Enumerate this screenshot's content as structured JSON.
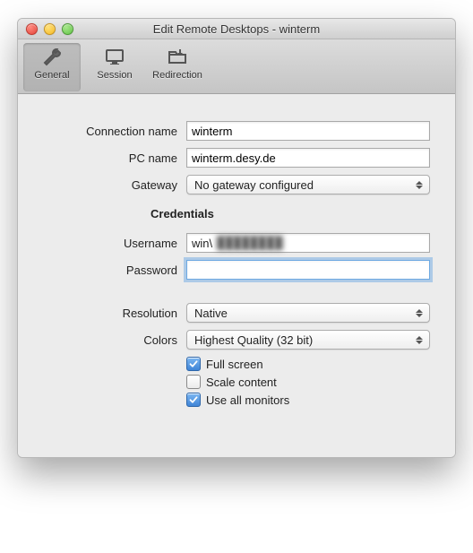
{
  "window": {
    "title": "Edit Remote Desktops - winterm"
  },
  "toolbar": {
    "general": "General",
    "session": "Session",
    "redirection": "Redirection"
  },
  "labels": {
    "connection_name": "Connection name",
    "pc_name": "PC name",
    "gateway": "Gateway",
    "credentials": "Credentials",
    "username": "Username",
    "password": "Password",
    "resolution": "Resolution",
    "colors": "Colors",
    "full_screen": "Full screen",
    "scale_content": "Scale content",
    "use_all_monitors": "Use all monitors"
  },
  "values": {
    "connection_name": "winterm",
    "pc_name": "winterm.desy.de",
    "gateway": "No gateway configured",
    "username_prefix": "win\\",
    "username_hidden": "████████",
    "password": "",
    "resolution": "Native",
    "colors": "Highest Quality (32 bit)"
  },
  "checks": {
    "full_screen": true,
    "scale_content": false,
    "use_all_monitors": true
  }
}
